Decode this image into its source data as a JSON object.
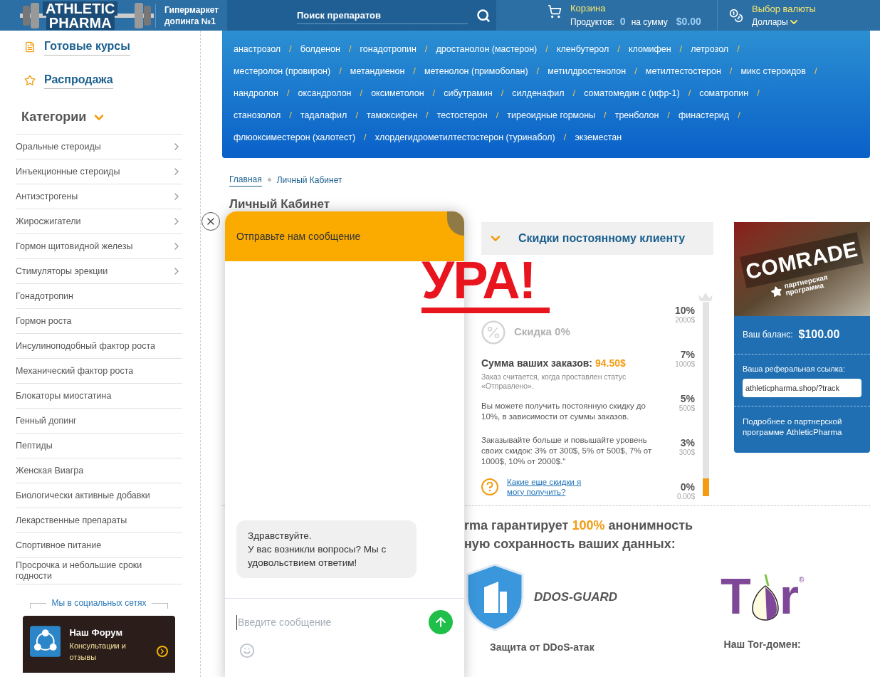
{
  "header": {
    "logo": {
      "line1": "ATHLETIC",
      "line2": "PHARMA"
    },
    "tagline": "Гипермаркет допинга №1",
    "search": {
      "placeholder": "Поиск препаратов"
    },
    "cart": {
      "title": "Корзина",
      "products_label": "Продуктов:",
      "products_count": "0",
      "sum_label": "на сумму",
      "sum": "$0.00"
    },
    "currency": {
      "title": "Выбор валюты",
      "value": "Доллары"
    }
  },
  "sidebar": {
    "links": [
      {
        "kind": "courses",
        "label": "Готовые курсы"
      },
      {
        "kind": "sale",
        "label": "Распродажа"
      }
    ],
    "categories_title": "Категории",
    "categories": [
      {
        "label": "Оральные стероиды",
        "has_submenu": true
      },
      {
        "label": "Инъекционные стероиды",
        "has_submenu": true
      },
      {
        "label": "Антиэстрогены",
        "has_submenu": true
      },
      {
        "label": "Жиросжигатели",
        "has_submenu": true
      },
      {
        "label": "Гормон щитовидной железы",
        "has_submenu": true
      },
      {
        "label": "Стимуляторы эрекции",
        "has_submenu": true
      },
      {
        "label": "Гонадотропин",
        "has_submenu": false
      },
      {
        "label": "Гормон роста",
        "has_submenu": false
      },
      {
        "label": "Инсулиноподобный фактор роста",
        "has_submenu": false
      },
      {
        "label": "Механический фактор роста",
        "has_submenu": false
      },
      {
        "label": "Блокаторы миостатина",
        "has_submenu": false
      },
      {
        "label": "Генный допинг",
        "has_submenu": false
      },
      {
        "label": "Пептиды",
        "has_submenu": false
      },
      {
        "label": "Женская Виагра",
        "has_submenu": false
      },
      {
        "label": "Биологически активные добавки",
        "has_submenu": false
      },
      {
        "label": "Лекарственные препараты",
        "has_submenu": false
      },
      {
        "label": "Спортивное питание",
        "has_submenu": false
      },
      {
        "label": "Просрочка и небольшие сроки годности",
        "has_submenu": false
      }
    ],
    "social_title": "Мы в социальных сетях",
    "forum": {
      "title": "Наш Форум",
      "subtitle": "Консультации и отзывы"
    }
  },
  "tags": {
    "separator": "/",
    "lines": [
      {
        "tags": [
          "анастрозол",
          "болденон",
          "гонадотропин",
          "дростанолон (мастерон)",
          "кленбутерол",
          "кломифен",
          "летрозол"
        ]
      },
      {
        "tags": [
          "местеролон (провирон)",
          "метандиенон",
          "метенолон (примоболан)",
          "метилдростенолон",
          "метилтестостерон",
          "микс стероидов"
        ]
      },
      {
        "tags": [
          "нандролон",
          "оксандролон",
          "оксиметолон",
          "сибутрамин",
          "силденафил",
          "соматомедин с (ифр-1)",
          "соматропин"
        ]
      },
      {
        "tags": [
          "станозолол",
          "тадалафил",
          "тамоксифен",
          "тестостерон",
          "тиреоидные гормоны",
          "тренболон",
          "финастерид"
        ]
      },
      {
        "tags": [
          "флюоксиместерон (халотест)",
          "хлордегидрометилтестостерон (туринабол)",
          "экземестан"
        ]
      }
    ]
  },
  "breadcrumb": [
    {
      "label": "Главная",
      "link": true
    },
    {
      "label": "Личный Кабинет",
      "link": false
    }
  ],
  "page_title": "Личный Кабинет",
  "discount": {
    "title": "Скидки постоянному клиенту",
    "current": "Скидка 0%",
    "sum_label": "Сумма ваших заказов:",
    "sum": "94.50$",
    "note": "Заказ считается, когда проставлен статус «Отправлено».",
    "info1": "Вы можете получить постоянную скидку до 10%, в зависимости от суммы заказов.",
    "info2": "Заказывайте больше и повышайте уровень своих скидок: 3% от 300$, 5% от 500$, 7% от 1000$, 10% от 2000$.\"",
    "help_link": "Какие еще скидки я могу получить?",
    "level": 0.09,
    "tiers": [
      {
        "percent": "10%",
        "amount": "2000$"
      },
      {
        "percent": "7%",
        "amount": "1000$"
      },
      {
        "percent": "5%",
        "amount": "500$"
      },
      {
        "percent": "3%",
        "amount": "300$"
      },
      {
        "percent": "0%",
        "amount": "0.00$"
      }
    ]
  },
  "partner": {
    "banner_title": "COMRADE",
    "banner_subtitle": "партнерская программа",
    "balance_label": "Ваш баланс:",
    "balance": "$100.00",
    "ref_label": "Ваша реферальная ссылка:",
    "ref_value": "athleticpharma.shop/?track",
    "more_link": "Подробнее о партнерской программе AthleticPharma"
  },
  "anonymity": {
    "line1": {
      "before": "rma гарантирует ",
      "highlight": "100%",
      "after": " анонимность"
    },
    "line2": "ную сохранность ваших данных:",
    "ddos": {
      "logo_text": "DDOS-GUARD",
      "caption": "Защита от DDoS-атак"
    },
    "tor": {
      "letter1": "T",
      "letter2": "r",
      "mark": "®",
      "caption": "Наш Tor-домен:"
    }
  },
  "chat": {
    "title": "Отправьте нам сообщение",
    "message_lines": [
      "Здравствуйте.",
      "У вас возникли вопросы? Мы с удовольствием ответим!"
    ],
    "input": {
      "placeholder": "Введите сообщение"
    }
  },
  "overlay_text": "УРА!"
}
